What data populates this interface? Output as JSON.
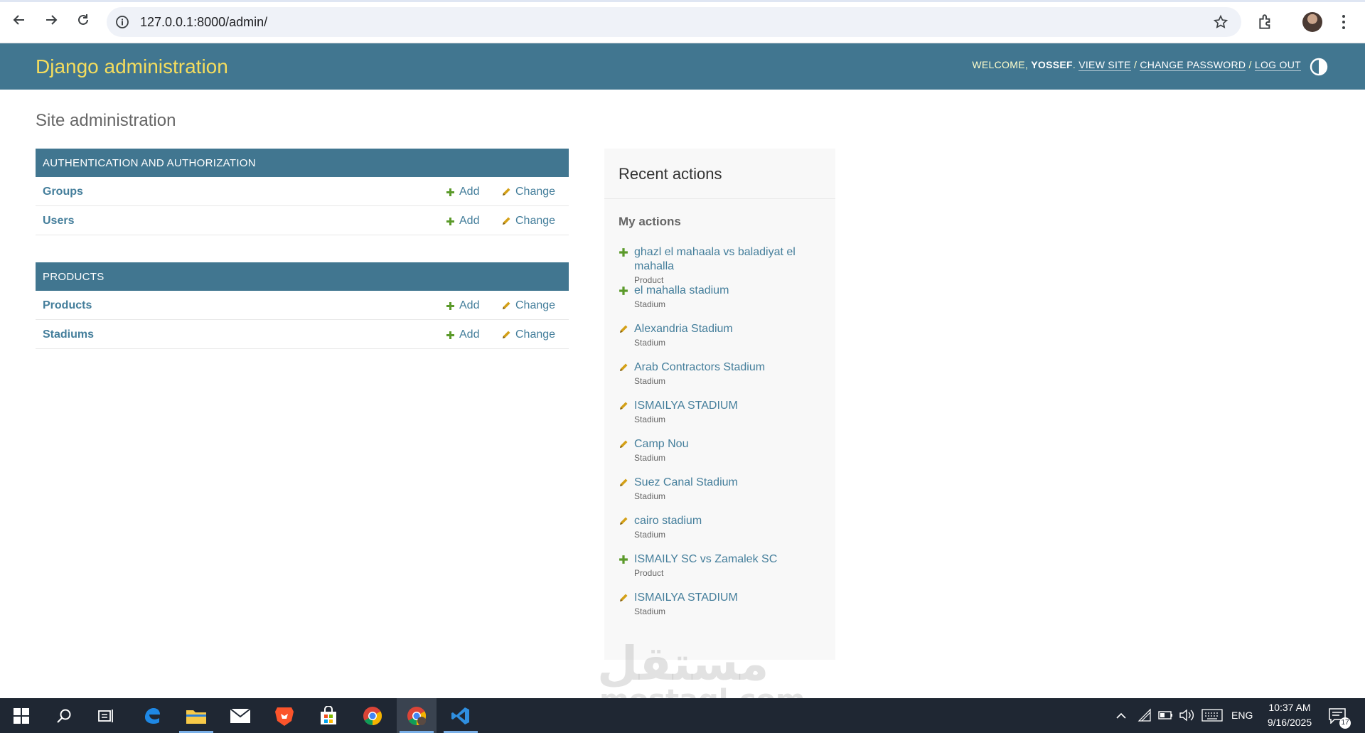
{
  "browser": {
    "url": "127.0.0.1:8000/admin/"
  },
  "header": {
    "branding": "Django administration",
    "welcome": "WELCOME,",
    "username": "YOSSEF",
    "view_site": "VIEW SITE",
    "change_password": "CHANGE PASSWORD",
    "log_out": "LOG OUT",
    "separator": "/"
  },
  "page": {
    "title": "Site administration"
  },
  "apps": [
    {
      "caption": "AUTHENTICATION AND AUTHORIZATION",
      "models": [
        {
          "name": "Groups",
          "add": "Add",
          "change": "Change"
        },
        {
          "name": "Users",
          "add": "Add",
          "change": "Change"
        }
      ]
    },
    {
      "caption": "PRODUCTS",
      "models": [
        {
          "name": "Products",
          "add": "Add",
          "change": "Change"
        },
        {
          "name": "Stadiums",
          "add": "Add",
          "change": "Change"
        }
      ]
    }
  ],
  "recent": {
    "title": "Recent actions",
    "my_actions": "My actions",
    "items": [
      {
        "action": "add",
        "name": "ghazl el mahaala vs baladiyat el mahalla",
        "type": "Product"
      },
      {
        "action": "add",
        "name": "el mahalla stadium",
        "type": "Stadium"
      },
      {
        "action": "change",
        "name": "Alexandria Stadium",
        "type": "Stadium"
      },
      {
        "action": "change",
        "name": "Arab Contractors Stadium",
        "type": "Stadium"
      },
      {
        "action": "change",
        "name": "ISMAILYA STADIUM",
        "type": "Stadium"
      },
      {
        "action": "change",
        "name": "Camp Nou",
        "type": "Stadium"
      },
      {
        "action": "change",
        "name": "Suez Canal Stadium",
        "type": "Stadium"
      },
      {
        "action": "change",
        "name": "cairo stadium",
        "type": "Stadium"
      },
      {
        "action": "add",
        "name": "ISMAILY SC vs Zamalek SC",
        "type": "Product"
      },
      {
        "action": "change",
        "name": "ISMAILYA STADIUM",
        "type": "Stadium"
      }
    ]
  },
  "watermark": {
    "arabic": "مستقل",
    "latin": "mostaql.com"
  },
  "taskbar": {
    "language": "ENG",
    "time": "10:37 AM",
    "date": "9/16/2025",
    "notifications": "17"
  },
  "colors": {
    "header_bg": "#417690",
    "branding": "#f5dd5d",
    "link": "#447e9b",
    "add_icon": "#5b9a2a",
    "change_icon": "#d4a017",
    "taskbar_bg": "#1f2733"
  }
}
